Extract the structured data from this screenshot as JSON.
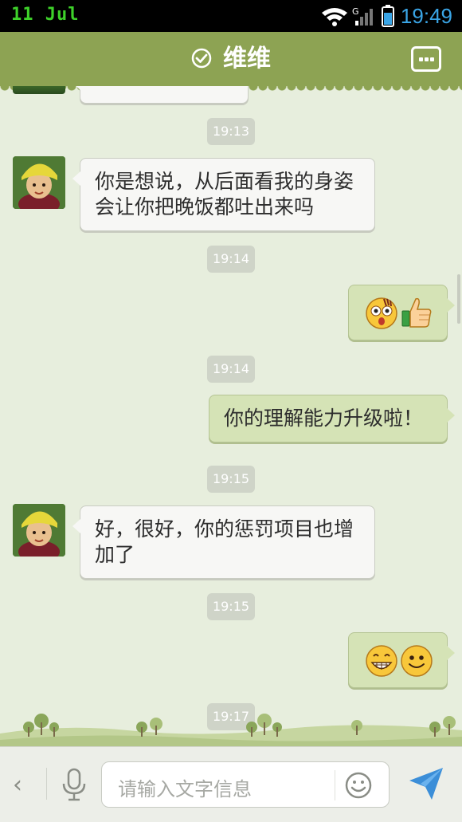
{
  "status_bar": {
    "date": "11 Jul",
    "time": "19:49",
    "icons": [
      "wifi-icon",
      "signal-icon",
      "battery-icon"
    ]
  },
  "header": {
    "title": "维维",
    "left_icon": "check-circle-icon",
    "right_icon": "more-menu-icon"
  },
  "messages": [
    {
      "type": "timestamp",
      "text": "19:13"
    },
    {
      "type": "received",
      "text": "你是想说，从后面看我的身姿会让你把晚饭都吐出来吗"
    },
    {
      "type": "timestamp",
      "text": "19:14"
    },
    {
      "type": "sent-emoji",
      "emojis": [
        "shocked-face-emoji",
        "thumbs-up-emoji"
      ]
    },
    {
      "type": "timestamp",
      "text": "19:14"
    },
    {
      "type": "sent",
      "text": "你的理解能力升级啦！"
    },
    {
      "type": "timestamp",
      "text": "19:15"
    },
    {
      "type": "received",
      "text": "好，很好，你的惩罚项目也增加了"
    },
    {
      "type": "timestamp",
      "text": "19:15"
    },
    {
      "type": "sent-emoji",
      "emojis": [
        "grin-emoji",
        "smile-emoji"
      ]
    },
    {
      "type": "timestamp",
      "text": "19:17"
    }
  ],
  "bottom_bar": {
    "input_placeholder": "请输入文字信息",
    "icons": [
      "back-arrow-icon",
      "microphone-icon",
      "smiley-icon",
      "send-icon"
    ]
  },
  "colors": {
    "header": "#8da353",
    "background": "#e7eedd",
    "sent_bubble": "#d5e3b6",
    "received_bubble": "#f7f7f5",
    "time_accent": "#3aa5e6",
    "date_accent": "#3ed12a"
  }
}
